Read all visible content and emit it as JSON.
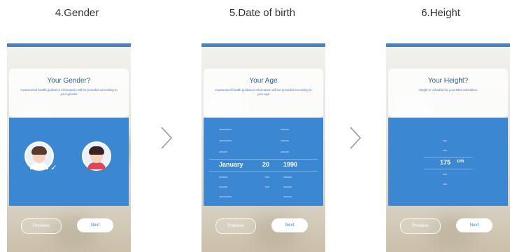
{
  "steps": [
    {
      "title": "4.Gender",
      "card_title": "Your Gender?",
      "card_subtitle": "Customized health guidance information will be provided according to your gender",
      "buttons": {
        "prev": "Previous",
        "next": "Next"
      }
    },
    {
      "title": "5.Date of birth",
      "card_title": "Your Age",
      "card_subtitle": "Customized health guidance information will be provided according to your age",
      "picker": {
        "selected": {
          "month": "January",
          "day": "20",
          "year": "1990"
        }
      },
      "buttons": {
        "prev": "Previous",
        "next": "Next"
      }
    },
    {
      "title": "6.Height",
      "card_title": "Your Height?",
      "card_subtitle": "Height is valuable for your BMI calculation",
      "picker": {
        "selected": {
          "value": "175",
          "unit": "cm"
        }
      },
      "buttons": {
        "prev": "Previous",
        "next": "Next"
      }
    }
  ],
  "colors": {
    "accent": "#3b87d2",
    "topbar": "#4a7fc1",
    "title_text": "#333333"
  },
  "icons": [
    "male-avatar-icon",
    "female-avatar-icon",
    "checkmark-icon",
    "chevron-right-icon"
  ]
}
